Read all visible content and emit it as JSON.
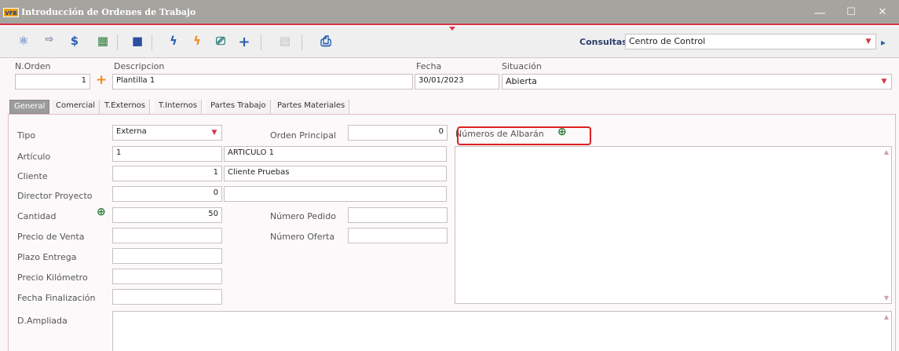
{
  "window": {
    "logo": "VFB",
    "title": "Introducción de Ordenes de Trabajo",
    "minimize": "—",
    "maximize": "☐",
    "close": "✕"
  },
  "toolbar": {
    "icons": {
      "atom": "⚛",
      "export": "⇨",
      "dollar": "$",
      "cube": "▦",
      "copy": "■",
      "bolt1": "ϟ",
      "bolt2": "ϟ",
      "doc_search": "⎚",
      "plus": "+",
      "disabled_doc": "▤",
      "print": "⎙"
    },
    "consultas_label": "Consultas",
    "consultas_value": "Centro de Control",
    "arrow": "▸"
  },
  "header": {
    "n_orden_label": "N.Orden",
    "n_orden_value": "1",
    "plus_symbol": "+",
    "descripcion_label": "Descripcion",
    "descripcion_value": "Plantilla 1",
    "fecha_label": "Fecha",
    "fecha_value": "30/01/2023",
    "situacion_label": "Situación",
    "situacion_value": "Abierta"
  },
  "tabs": [
    "General",
    "Comercial",
    "T.Externos",
    "T.Internos",
    "Partes Trabajo",
    "Partes Materiales"
  ],
  "form": {
    "tipo_label": "Tipo",
    "tipo_value": "Externa",
    "orden_principal_label": "Orden Principal",
    "orden_principal_value": "0",
    "numeros_albaran_label": "Números de Albarán",
    "articulo_label": "Artículo",
    "articulo_code": "1",
    "articulo_name": "ARTICULO 1",
    "cliente_label": "Cliente",
    "cliente_code": "1",
    "cliente_name": "Cliente Pruebas",
    "director_label": "Director Proyecto",
    "director_code": "0",
    "director_name": "",
    "cantidad_label": "Cantidad",
    "cantidad_value": "50",
    "numero_pedido_label": "Número Pedido",
    "numero_pedido_value": "",
    "precio_venta_label": "Precio de Venta",
    "precio_venta_value": "",
    "numero_oferta_label": "Número Oferta",
    "numero_oferta_value": "",
    "plazo_entrega_label": "Plazo Entrega",
    "plazo_entrega_value": "",
    "precio_km_label": "Precio Kilómetro",
    "precio_km_value": "",
    "fecha_fin_label": "Fecha Finalización",
    "fecha_fin_value": "",
    "d_ampliada_label": "D.Ampliada",
    "zoom_symbol": "⊕",
    "dropdown_symbol": "▼",
    "scroll_up": "▲",
    "scroll_down": "▼"
  },
  "colors": {
    "accent": "#d23a4a",
    "titlebar": "#a6a49f",
    "highlight": "#e02020"
  }
}
